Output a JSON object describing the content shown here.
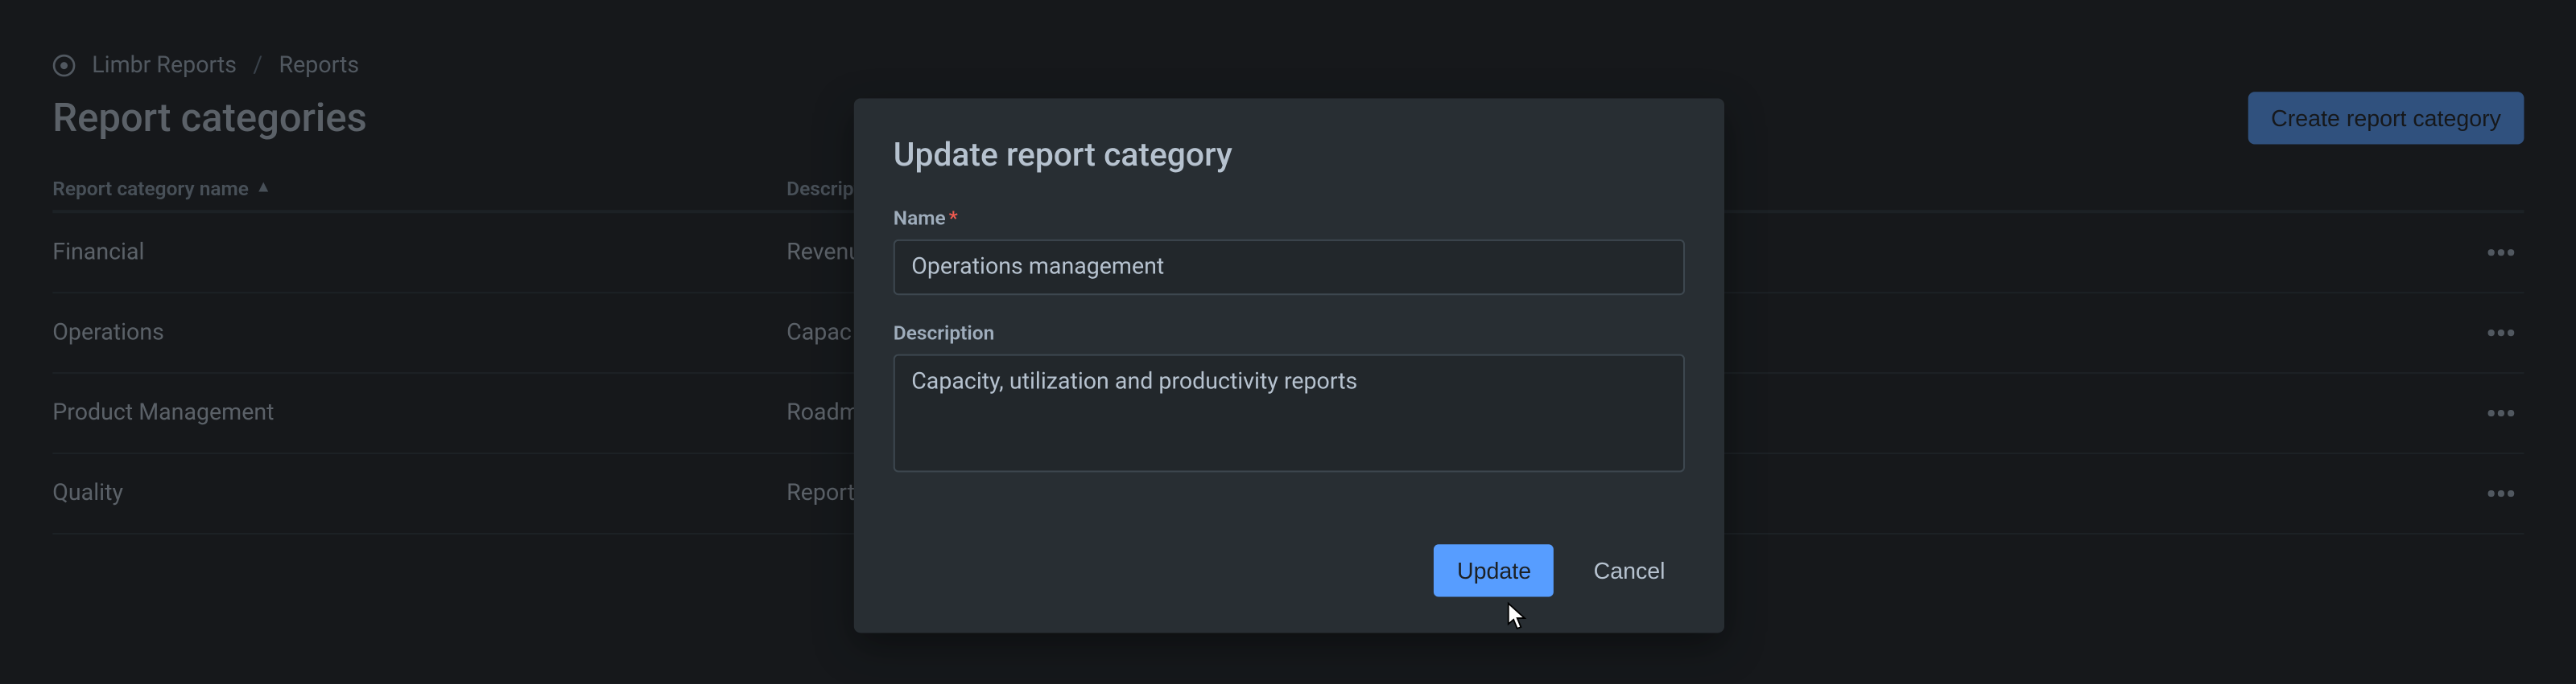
{
  "breadcrumb": {
    "root": "Limbr Reports",
    "current": "Reports"
  },
  "header": {
    "title": "Report categories",
    "create_button": "Create report category"
  },
  "table": {
    "columns": {
      "name": "Report category name",
      "description": "Description"
    },
    "rows": [
      {
        "name": "Financial",
        "description": "Revenu"
      },
      {
        "name": "Operations",
        "description": "Capac"
      },
      {
        "name": "Product Management",
        "description": "Roadm"
      },
      {
        "name": "Quality",
        "description": "Report"
      }
    ]
  },
  "modal": {
    "title": "Update report category",
    "name_label": "Name",
    "name_value": "Operations management",
    "description_label": "Description",
    "description_value": "Capacity, utilization and productivity reports",
    "update_button": "Update",
    "cancel_button": "Cancel"
  }
}
